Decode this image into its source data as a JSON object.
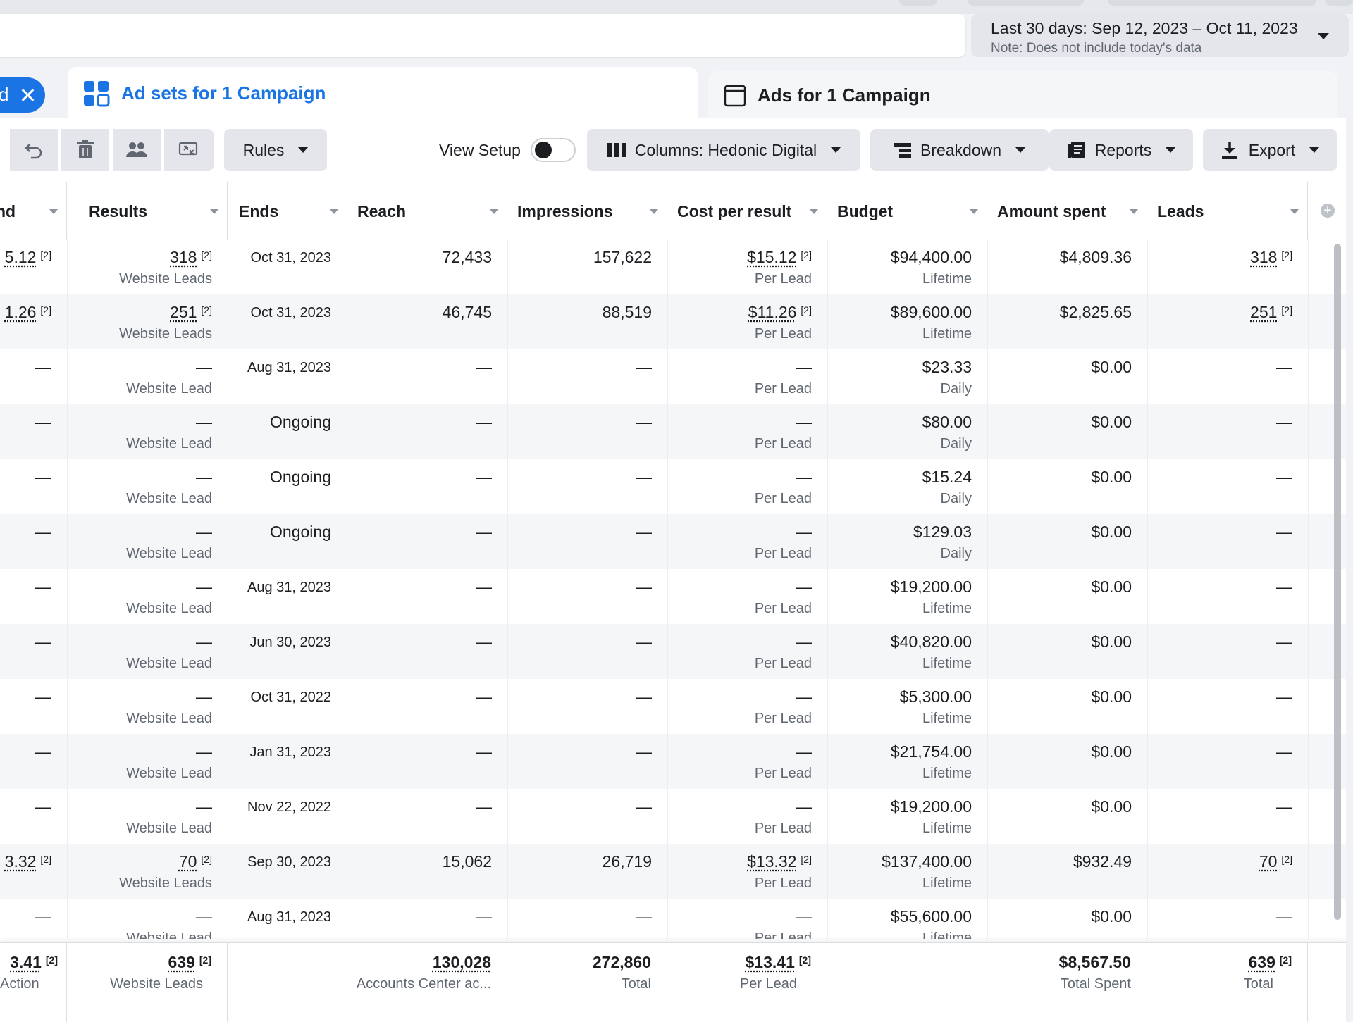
{
  "date_range": {
    "label": "Last 30 days: Sep 12, 2023 – Oct 11, 2023",
    "note": "Note: Does not include today's data"
  },
  "filter_chip": {
    "text": "d"
  },
  "tabs": {
    "adsets": "Ad sets for 1 Campaign",
    "ads": "Ads for 1 Campaign"
  },
  "toolbar": {
    "rules": "Rules",
    "view_setup": "View Setup",
    "columns": "Columns: Hedonic Digital",
    "breakdown": "Breakdown",
    "reports": "Reports",
    "export": "Export"
  },
  "columns": [
    "nd",
    "Results",
    "Ends",
    "Reach",
    "Impressions",
    "Cost per result",
    "Budget",
    "Amount spent",
    "Leads"
  ],
  "rows": [
    {
      "c0": "5.12",
      "c0_sup": "[2]",
      "results": "318",
      "results_sup": "[2]",
      "results_sub": "Website Leads",
      "ends": "Oct 31, 2023",
      "reach": "72,433",
      "impr": "157,622",
      "cpr": "$15.12",
      "cpr_sup": "[2]",
      "cpr_sub": "Per Lead",
      "budget": "$94,400.00",
      "budget_sub": "Lifetime",
      "spent": "$4,809.36",
      "leads": "318",
      "leads_sup": "[2]"
    },
    {
      "c0": "1.26",
      "c0_sup": "[2]",
      "results": "251",
      "results_sup": "[2]",
      "results_sub": "Website Leads",
      "ends": "Oct 31, 2023",
      "reach": "46,745",
      "impr": "88,519",
      "cpr": "$11.26",
      "cpr_sup": "[2]",
      "cpr_sub": "Per Lead",
      "budget": "$89,600.00",
      "budget_sub": "Lifetime",
      "spent": "$2,825.65",
      "leads": "251",
      "leads_sup": "[2]"
    },
    {
      "c0": "—",
      "results": "—",
      "results_sub": "Website Lead",
      "ends": "Aug 31, 2023",
      "reach": "—",
      "impr": "—",
      "cpr": "—",
      "cpr_sub": "Per Lead",
      "budget": "$23.33",
      "budget_sub": "Daily",
      "spent": "$0.00",
      "leads": "—"
    },
    {
      "c0": "—",
      "results": "—",
      "results_sub": "Website Lead",
      "ends": "Ongoing",
      "reach": "—",
      "impr": "—",
      "cpr": "—",
      "cpr_sub": "Per Lead",
      "budget": "$80.00",
      "budget_sub": "Daily",
      "spent": "$0.00",
      "leads": "—"
    },
    {
      "c0": "—",
      "results": "—",
      "results_sub": "Website Lead",
      "ends": "Ongoing",
      "reach": "—",
      "impr": "—",
      "cpr": "—",
      "cpr_sub": "Per Lead",
      "budget": "$15.24",
      "budget_sub": "Daily",
      "spent": "$0.00",
      "leads": "—"
    },
    {
      "c0": "—",
      "results": "—",
      "results_sub": "Website Lead",
      "ends": "Ongoing",
      "reach": "—",
      "impr": "—",
      "cpr": "—",
      "cpr_sub": "Per Lead",
      "budget": "$129.03",
      "budget_sub": "Daily",
      "spent": "$0.00",
      "leads": "—"
    },
    {
      "c0": "—",
      "results": "—",
      "results_sub": "Website Lead",
      "ends": "Aug 31, 2023",
      "reach": "—",
      "impr": "—",
      "cpr": "—",
      "cpr_sub": "Per Lead",
      "budget": "$19,200.00",
      "budget_sub": "Lifetime",
      "spent": "$0.00",
      "leads": "—"
    },
    {
      "c0": "—",
      "results": "—",
      "results_sub": "Website Lead",
      "ends": "Jun 30, 2023",
      "reach": "—",
      "impr": "—",
      "cpr": "—",
      "cpr_sub": "Per Lead",
      "budget": "$40,820.00",
      "budget_sub": "Lifetime",
      "spent": "$0.00",
      "leads": "—"
    },
    {
      "c0": "—",
      "results": "—",
      "results_sub": "Website Lead",
      "ends": "Oct 31, 2022",
      "reach": "—",
      "impr": "—",
      "cpr": "—",
      "cpr_sub": "Per Lead",
      "budget": "$5,300.00",
      "budget_sub": "Lifetime",
      "spent": "$0.00",
      "leads": "—"
    },
    {
      "c0": "—",
      "results": "—",
      "results_sub": "Website Lead",
      "ends": "Jan 31, 2023",
      "reach": "—",
      "impr": "—",
      "cpr": "—",
      "cpr_sub": "Per Lead",
      "budget": "$21,754.00",
      "budget_sub": "Lifetime",
      "spent": "$0.00",
      "leads": "—"
    },
    {
      "c0": "—",
      "results": "—",
      "results_sub": "Website Lead",
      "ends": "Nov 22, 2022",
      "reach": "—",
      "impr": "—",
      "cpr": "—",
      "cpr_sub": "Per Lead",
      "budget": "$19,200.00",
      "budget_sub": "Lifetime",
      "spent": "$0.00",
      "leads": "—"
    },
    {
      "c0": "3.32",
      "c0_sup": "[2]",
      "results": "70",
      "results_sup": "[2]",
      "results_sub": "Website Leads",
      "ends": "Sep 30, 2023",
      "reach": "15,062",
      "impr": "26,719",
      "cpr": "$13.32",
      "cpr_sup": "[2]",
      "cpr_sub": "Per Lead",
      "budget": "$137,400.00",
      "budget_sub": "Lifetime",
      "spent": "$932.49",
      "leads": "70",
      "leads_sup": "[2]"
    },
    {
      "c0": "—",
      "results": "—",
      "results_sub": "Website Lead",
      "ends": "Aug 31, 2023",
      "reach": "—",
      "impr": "—",
      "cpr": "—",
      "cpr_sub": "Per Lead",
      "budget": "$55,600.00",
      "budget_sub": "Lifetime",
      "spent": "$0.00",
      "leads": "—"
    }
  ],
  "totals": {
    "c0": "3.41",
    "c0_sup": "[2]",
    "c0_sub": "Action",
    "results": "639",
    "results_sup": "[2]",
    "results_sub": "Website Leads",
    "reach": "130,028",
    "reach_sub": "Accounts Center ac...",
    "impr": "272,860",
    "impr_sub": "Total",
    "cpr": "$13.41",
    "cpr_sup": "[2]",
    "cpr_sub": "Per Lead",
    "spent": "$8,567.50",
    "spent_sub": "Total Spent",
    "leads": "639",
    "leads_sup": "[2]",
    "leads_sub": "Total"
  }
}
